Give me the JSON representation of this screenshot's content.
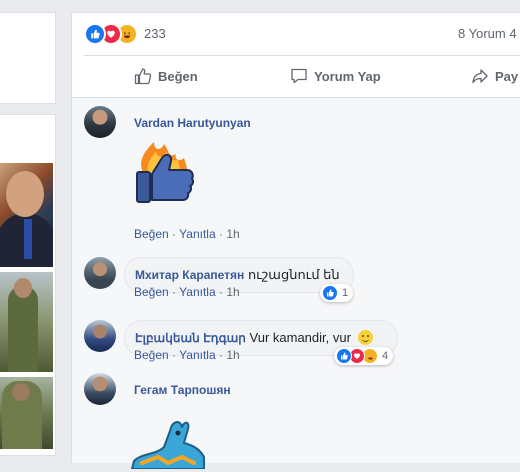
{
  "post": {
    "reaction_count": "233",
    "comment_count": "8 Yorum 4",
    "actions": {
      "like": "Beğen",
      "comment": "Yorum Yap",
      "share": "Pay"
    }
  },
  "comments": [
    {
      "author": "Vardan Harutyunyan",
      "text": "",
      "sticker": "thumbs-up-fire",
      "like": "Beğen",
      "reply": "Yanıtla",
      "time": "1h"
    },
    {
      "author": "Мхитар Карапетян",
      "text": "ուշացնում են",
      "like": "Beğen",
      "reply": "Yanıtla",
      "time": "1h",
      "reaction_count": "1"
    },
    {
      "author": "Էլբակեան Էդգար",
      "text": "Vur kamandir, vur",
      "like": "Beğen",
      "reply": "Yanıtla",
      "time": "1h",
      "reaction_count": "4"
    },
    {
      "author": "Гегам Тарпошян",
      "text": "",
      "sticker": "blue-bird"
    }
  ],
  "colors": {
    "link": "#385898",
    "like_blue": "#1877f2",
    "love_red": "#f0284a",
    "haha_yellow": "#f7b125"
  }
}
